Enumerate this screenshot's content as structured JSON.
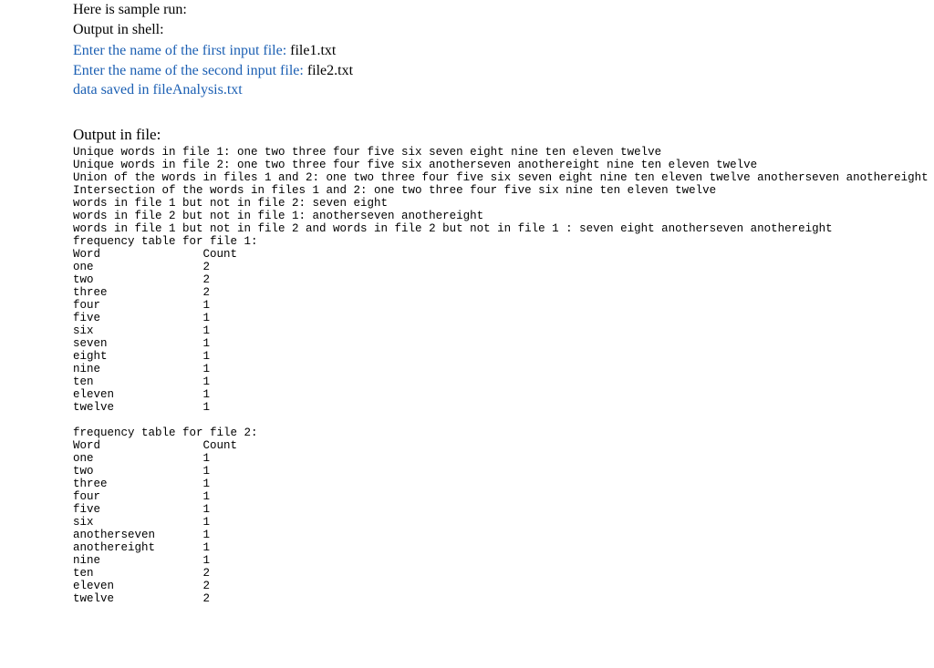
{
  "intro": {
    "l1": "Here is sample run:",
    "l2": "Output in shell:"
  },
  "shell": {
    "p1_prompt": "Enter the name of the first input file: ",
    "p1_value": "file1.txt",
    "p2_prompt": "Enter the name of the second input file: ",
    "p2_value": "file2.txt",
    "saved": "data saved in fileAnalysis.txt"
  },
  "file_section_title": "Output in file:",
  "file_output": {
    "unique1": "Unique words in file 1: one two three four five six seven eight nine ten eleven twelve",
    "unique2": "Unique words in file 2: one two three four five six anotherseven anothereight nine ten eleven twelve",
    "union": "Union of the words in files 1 and 2: one two three four five six seven eight nine ten eleven twelve anotherseven anothereight",
    "intersection": "Intersection of the words in files 1 and 2: one two three four five six nine ten eleven twelve",
    "diff1": "words in file 1 but not in file 2: seven eight",
    "diff2": "words in file 2 but not in file 1: anotherseven anothereight",
    "symdiff": "words in file 1 but not in file 2 and words in file 2 but not in file 1 : seven eight anotherseven anothereight",
    "freq1_title": "frequency table for file 1:",
    "freq_header_word": "Word",
    "freq_header_count": "Count",
    "freq1": [
      {
        "w": "one",
        "c": "2"
      },
      {
        "w": "two",
        "c": "2"
      },
      {
        "w": "three",
        "c": "2"
      },
      {
        "w": "four",
        "c": "1"
      },
      {
        "w": "five",
        "c": "1"
      },
      {
        "w": "six",
        "c": "1"
      },
      {
        "w": "seven",
        "c": "1"
      },
      {
        "w": "eight",
        "c": "1"
      },
      {
        "w": "nine",
        "c": "1"
      },
      {
        "w": "ten",
        "c": "1"
      },
      {
        "w": "eleven",
        "c": "1"
      },
      {
        "w": "twelve",
        "c": "1"
      }
    ],
    "freq2_title": "frequency table for file 2:",
    "freq2": [
      {
        "w": "one",
        "c": "1"
      },
      {
        "w": "two",
        "c": "1"
      },
      {
        "w": "three",
        "c": "1"
      },
      {
        "w": "four",
        "c": "1"
      },
      {
        "w": "five",
        "c": "1"
      },
      {
        "w": "six",
        "c": "1"
      },
      {
        "w": "anotherseven",
        "c": "1"
      },
      {
        "w": "anothereight",
        "c": "1"
      },
      {
        "w": "nine",
        "c": "1"
      },
      {
        "w": "ten",
        "c": "2"
      },
      {
        "w": "eleven",
        "c": "2"
      },
      {
        "w": "twelve",
        "c": "2"
      }
    ]
  }
}
